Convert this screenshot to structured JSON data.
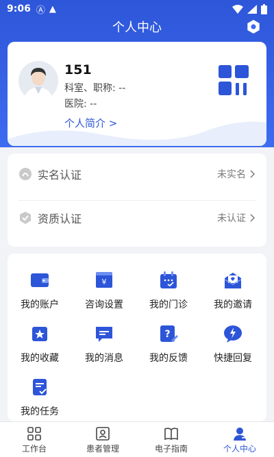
{
  "status_bar": {
    "time": "9:06"
  },
  "header": {
    "title": "个人中心"
  },
  "profile": {
    "name": "151",
    "department_title": "科室、职称: --",
    "hospital": "医院: --",
    "intro_link": "个人简介 >"
  },
  "auth": {
    "realname": {
      "label": "实名认证",
      "value": "未实名"
    },
    "qualification": {
      "label": "资质认证",
      "value": "未认证"
    }
  },
  "menu": {
    "items": [
      {
        "label": "我的账户",
        "icon": "wallet-icon"
      },
      {
        "label": "咨询设置",
        "icon": "consult-settings-icon"
      },
      {
        "label": "我的门诊",
        "icon": "calendar-icon"
      },
      {
        "label": "我的邀请",
        "icon": "invite-mail-icon"
      },
      {
        "label": "我的收藏",
        "icon": "star-folder-icon"
      },
      {
        "label": "我的消息",
        "icon": "message-icon"
      },
      {
        "label": "我的反馈",
        "icon": "feedback-icon"
      },
      {
        "label": "快捷回复",
        "icon": "quick-reply-icon"
      },
      {
        "label": "我的任务",
        "icon": "task-icon"
      }
    ]
  },
  "tabs": [
    {
      "label": "工作台",
      "icon": "grid-icon"
    },
    {
      "label": "患者管理",
      "icon": "patient-card-icon"
    },
    {
      "label": "电子指南",
      "icon": "book-icon"
    },
    {
      "label": "个人中心",
      "icon": "person-icon"
    }
  ],
  "colors": {
    "primary": "#2d55d8",
    "header_bg": "#3d6cf0",
    "page_bg": "#f2f3f7"
  }
}
